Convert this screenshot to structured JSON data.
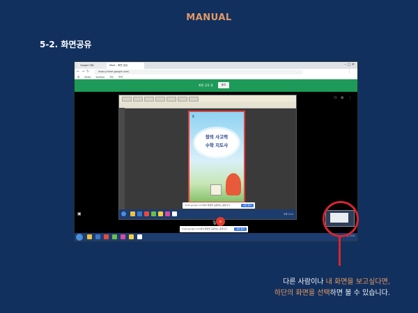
{
  "page": {
    "header": "MANUAL",
    "section_title": "5-2. 화면공유"
  },
  "browser": {
    "tabs": [
      "Google 미트",
      "Meet - 화면 공유"
    ],
    "window_controls": "–  □  ✕",
    "address": "https://meet.google.com/",
    "bookmarks": [
      "앱",
      "Gmail",
      "YouTube",
      "지도",
      "번역"
    ],
    "share_banner_text": "화면 공유 중",
    "share_banner_button": "중지"
  },
  "shared_screen": {
    "doc_header": "5",
    "doc_title_line1": "창의 사고력",
    "doc_title_line2": "수학 지도사",
    "notice_text": "meet.google.com에서 화면을 공유하는 중입니다.",
    "notice_button": "공유 중지",
    "tray_text": "오후 2:14"
  },
  "controls": {
    "notice_text": "meet.google.com에서 화면을 공유하는 중입니다.",
    "notice_button": "공유 중지",
    "clock": "오후 2:14"
  },
  "caption": {
    "line1_prefix": "다른 사람이나 ",
    "line1_highlight": "내 화면을 보고싶다면,",
    "line2_prefix": "하단의 화면을 선택",
    "line2_suffix": "하면 볼 수 있습니다."
  },
  "colors": {
    "background": "#12305e",
    "accent": "#e49a62",
    "highlight_circle": "#d82530",
    "meet_green": "#1e9a58"
  }
}
